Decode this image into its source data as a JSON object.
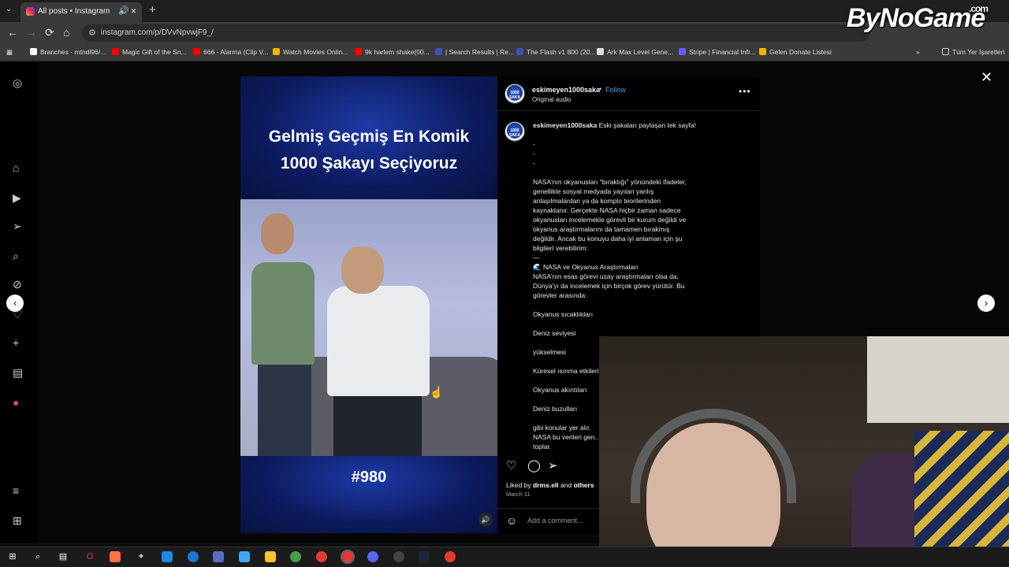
{
  "browser": {
    "tab": {
      "title": "All posts • Instagram"
    },
    "url": "instagram.com/p/DVvNpvwjF9_/",
    "bookmarks": [
      {
        "label": "Branches · mtndl96/...",
        "color": "#ffffff"
      },
      {
        "label": "Magic Gift of the Sn...",
        "color": "#ff0000"
      },
      {
        "label": "666 - Alarma (Clip V...",
        "color": "#ff0000"
      },
      {
        "label": "Watch Movies Onlin...",
        "color": "#f4b400"
      },
      {
        "label": "9k harlem shake(00...",
        "color": "#ff0000"
      },
      {
        "label": "| Search Results | Re...",
        "color": "#3f51b5"
      },
      {
        "label": "The Flash v1 800 (20...",
        "color": "#3f51b5"
      },
      {
        "label": "Ark Max Level Gene...",
        "color": "#e0e0e0"
      },
      {
        "label": "Stripe | Financial Infr...",
        "color": "#635bff"
      },
      {
        "label": "Gelen Donate Listesi",
        "color": "#f4b400"
      }
    ],
    "bookmarks_folder": "Tüm Yer İşaretleri"
  },
  "watermark": {
    "text": "ByNoGame",
    "suffix": ".com"
  },
  "video": {
    "title_line1": "Gelmiş Geçmiş En Komik",
    "title_line2": "1000 Şakayı Seçiyoruz",
    "number": "#980"
  },
  "post": {
    "username": "eskimeyen1000saka",
    "follow_label": "Follow",
    "audio": "Original audio",
    "avatar_text": "1000 ŞAKA",
    "caption_intro": "Eski şakaları paylaşan tek sayfa!",
    "caption_lines": [
      "-",
      "-",
      "-",
      "",
      "NASA'nın okyanusları \"bıraktığı\" yönündeki ifadeler,",
      "genellikle sosyal medyada yayılan yanlış",
      "anlaşılmalardan ya da komplo teorilerinden",
      "kaynaklanır. Gerçekte NASA hiçbir zaman sadece",
      "okyanusları incelemekle görevli bir kurum değildi ve",
      "okyanus araştırmalarını da tamamen bırakmış",
      "değildir. Ancak bu konuyu daha iyi anlaman için şu",
      "bilgileri verebilirim:",
      "—",
      "🌊 NASA ve Okyanus Araştırmaları",
      "NASA'nın esas görevi uzay araştırmaları olsa da,",
      "Dünya'yı da incelemek için birçok görev yürütür. Bu",
      "görevler arasında:",
      "",
      "Okyanus sıcaklıkları",
      "",
      "Deniz seviyesi",
      "",
      "yükselmesi",
      "",
      "Küresel ısınma etkileri",
      "",
      "Okyanus akıntıları",
      "",
      "Deniz buzulları",
      "",
      "gibi konular yer alır.",
      "NASA bu verileri gen...",
      "toplar."
    ],
    "liked_by_prefix": "Liked by",
    "liked_by_user": "drms.ell",
    "liked_by_and": "and",
    "liked_by_others": "others",
    "date": "March 11",
    "comment_placeholder": "Add a comment..."
  }
}
